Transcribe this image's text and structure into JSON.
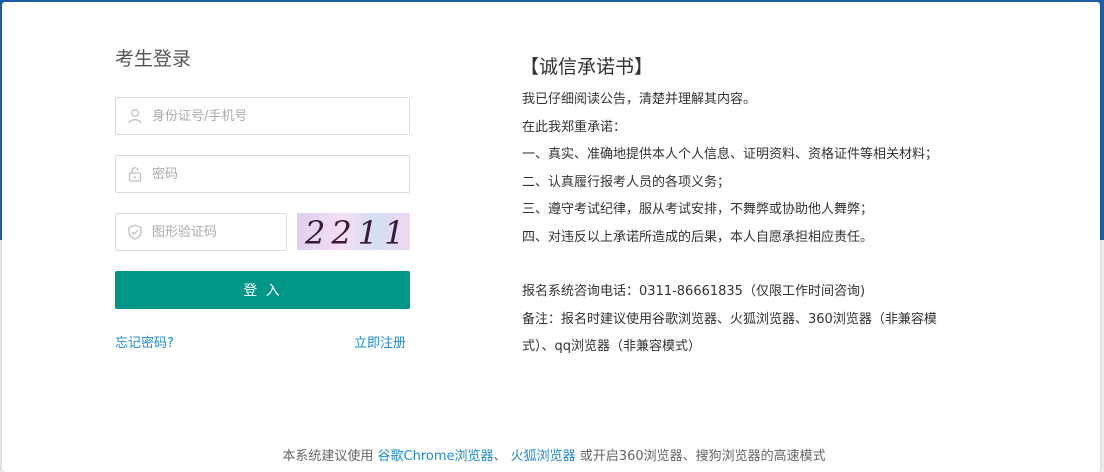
{
  "login": {
    "title": "考生登录",
    "id_placeholder": "身份证号/手机号",
    "password_placeholder": "密码",
    "captcha_placeholder": "图形验证码",
    "captcha_text": "2211",
    "submit_label": "登 入",
    "forgot_label": "忘记密码?",
    "register_label": "立即注册"
  },
  "promise": {
    "title": "【诚信承诺书】",
    "lines": [
      "我已仔细阅读公告，清楚并理解其内容。",
      "在此我郑重承诺：",
      "一、真实、准确地提供本人个人信息、证明资料、资格证件等相关材料；",
      "二、认真履行报考人员的各项义务；",
      "三、遵守考试纪律，服从考试安排，不舞弊或协助他人舞弊；",
      "四、对违反以上承诺所造成的后果，本人自愿承担相应责任。"
    ],
    "hotline": "报名系统咨询电话：0311-86661835（仅限工作时间咨询)",
    "note": "备注：报名时建议使用谷歌浏览器、火狐浏览器、360浏览器（非兼容模式）、qq浏览器（非兼容模式）"
  },
  "footer": {
    "prefix": "本系统建议使用 ",
    "chrome_link": "谷歌Chrome浏览器",
    "sep": "、 ",
    "firefox_link": "火狐浏览器",
    "suffix": " 或开启360浏览器、搜狗浏览器的高速模式"
  },
  "colors": {
    "accent": "#009688",
    "link": "#1e8ccc",
    "header_bg": "#1f5fa8"
  },
  "icons": {
    "id": "user-icon",
    "password": "lock-icon",
    "captcha": "shield-icon"
  }
}
